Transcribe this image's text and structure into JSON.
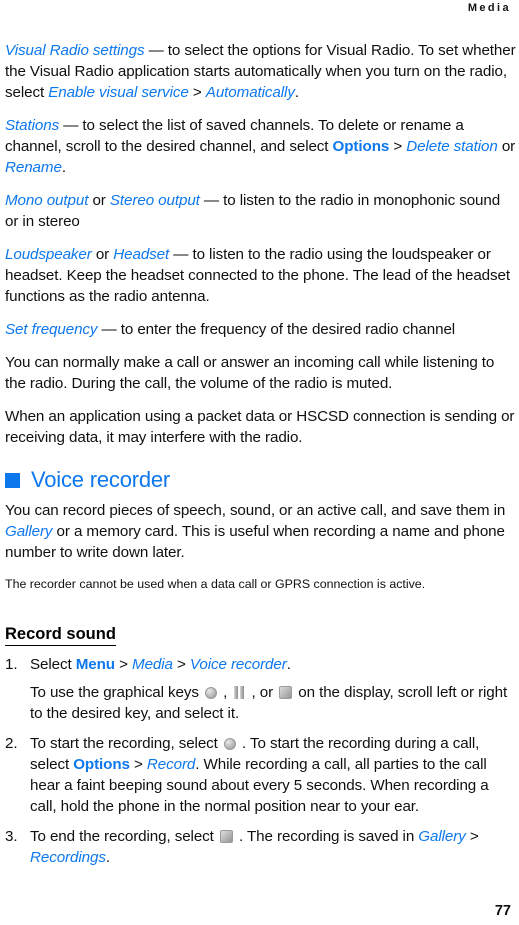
{
  "document": {
    "running_header": "Media",
    "page_number": "77",
    "accent_color": "#0d78ee",
    "text_color": "#101010",
    "background_color": "#ffffff"
  },
  "paragraphs": {
    "visual_radio_settings": {
      "term": "Visual Radio settings",
      "dash": " — to select the options for Visual Radio. To set whether the Visual Radio application starts automatically when you turn on the radio, select ",
      "cmd1": "Enable visual service",
      "sep": " > ",
      "cmd2": "Automatically",
      "end": "."
    },
    "stations": {
      "term": "Stations",
      "dash": " — to select the list of saved channels. To delete or rename a channel, scroll to the desired channel, and select ",
      "cmd1": "Options",
      "sep": " > ",
      "cmd2": "Delete station",
      "mid": " or ",
      "cmd3": "Rename",
      "end": "."
    },
    "output": {
      "term1": "Mono output",
      "or": " or ",
      "term2": "Stereo output",
      "rest": " — to listen to the radio in monophonic sound or in stereo"
    },
    "speaker": {
      "term1": "Loudspeaker",
      "or": " or ",
      "term2": "Headset",
      "rest": " — to listen to the radio using the loudspeaker or headset. Keep the headset connected to the phone. The lead of the headset functions as the radio antenna."
    },
    "set_frequency": {
      "term": "Set frequency",
      "rest": " — to enter the frequency of the desired radio channel"
    },
    "call_while_listening": "You can normally make a call or answer an incoming call while listening to the radio. During the call, the volume of the radio is muted.",
    "packet_data": "When an application using a packet data or HSCSD connection is sending or receiving data, it may interfere with the radio."
  },
  "voice_recorder": {
    "heading": "Voice recorder",
    "intro": {
      "part1": "You can record pieces of speech, sound, or an active call, and save them in ",
      "term": "Gallery",
      "part2": " or a memory card. This is useful when recording a name and phone number to write down later."
    },
    "note": "The recorder cannot be used when a data call or GPRS connection is active.",
    "record_sound_heading": "Record sound",
    "steps": {
      "step1": {
        "number": "1.",
        "text_before": "Select ",
        "cmd1": "Menu",
        "sep1": " > ",
        "cmd2": "Media",
        "sep2": " > ",
        "cmd3": "Voice recorder",
        "end": ".",
        "substep_before": "To use the graphical keys ",
        "substep_mid1": " , ",
        "substep_mid2": " , or ",
        "substep_after": " on the display, scroll left or right to the desired key, and select it."
      },
      "step2": {
        "number": "2.",
        "text_before": "To start the recording, select ",
        "text_mid": " . To start the recording during a call, select ",
        "cmd1": "Options",
        "sep": " > ",
        "cmd2": "Record",
        "text_after": ". While recording a call, all parties to the call hear a faint beeping sound about every 5 seconds. When recording a call, hold the phone in the normal position near to your ear."
      },
      "step3": {
        "number": "3.",
        "text_before": "To end the recording, select ",
        "text_mid": " . The recording is saved in ",
        "cmd1": "Gallery",
        "sep": " > ",
        "cmd2": "Recordings",
        "end": "."
      }
    },
    "icons": {
      "record": "record-circle-icon",
      "pause": "pause-bars-icon",
      "stop": "stop-square-icon"
    }
  }
}
